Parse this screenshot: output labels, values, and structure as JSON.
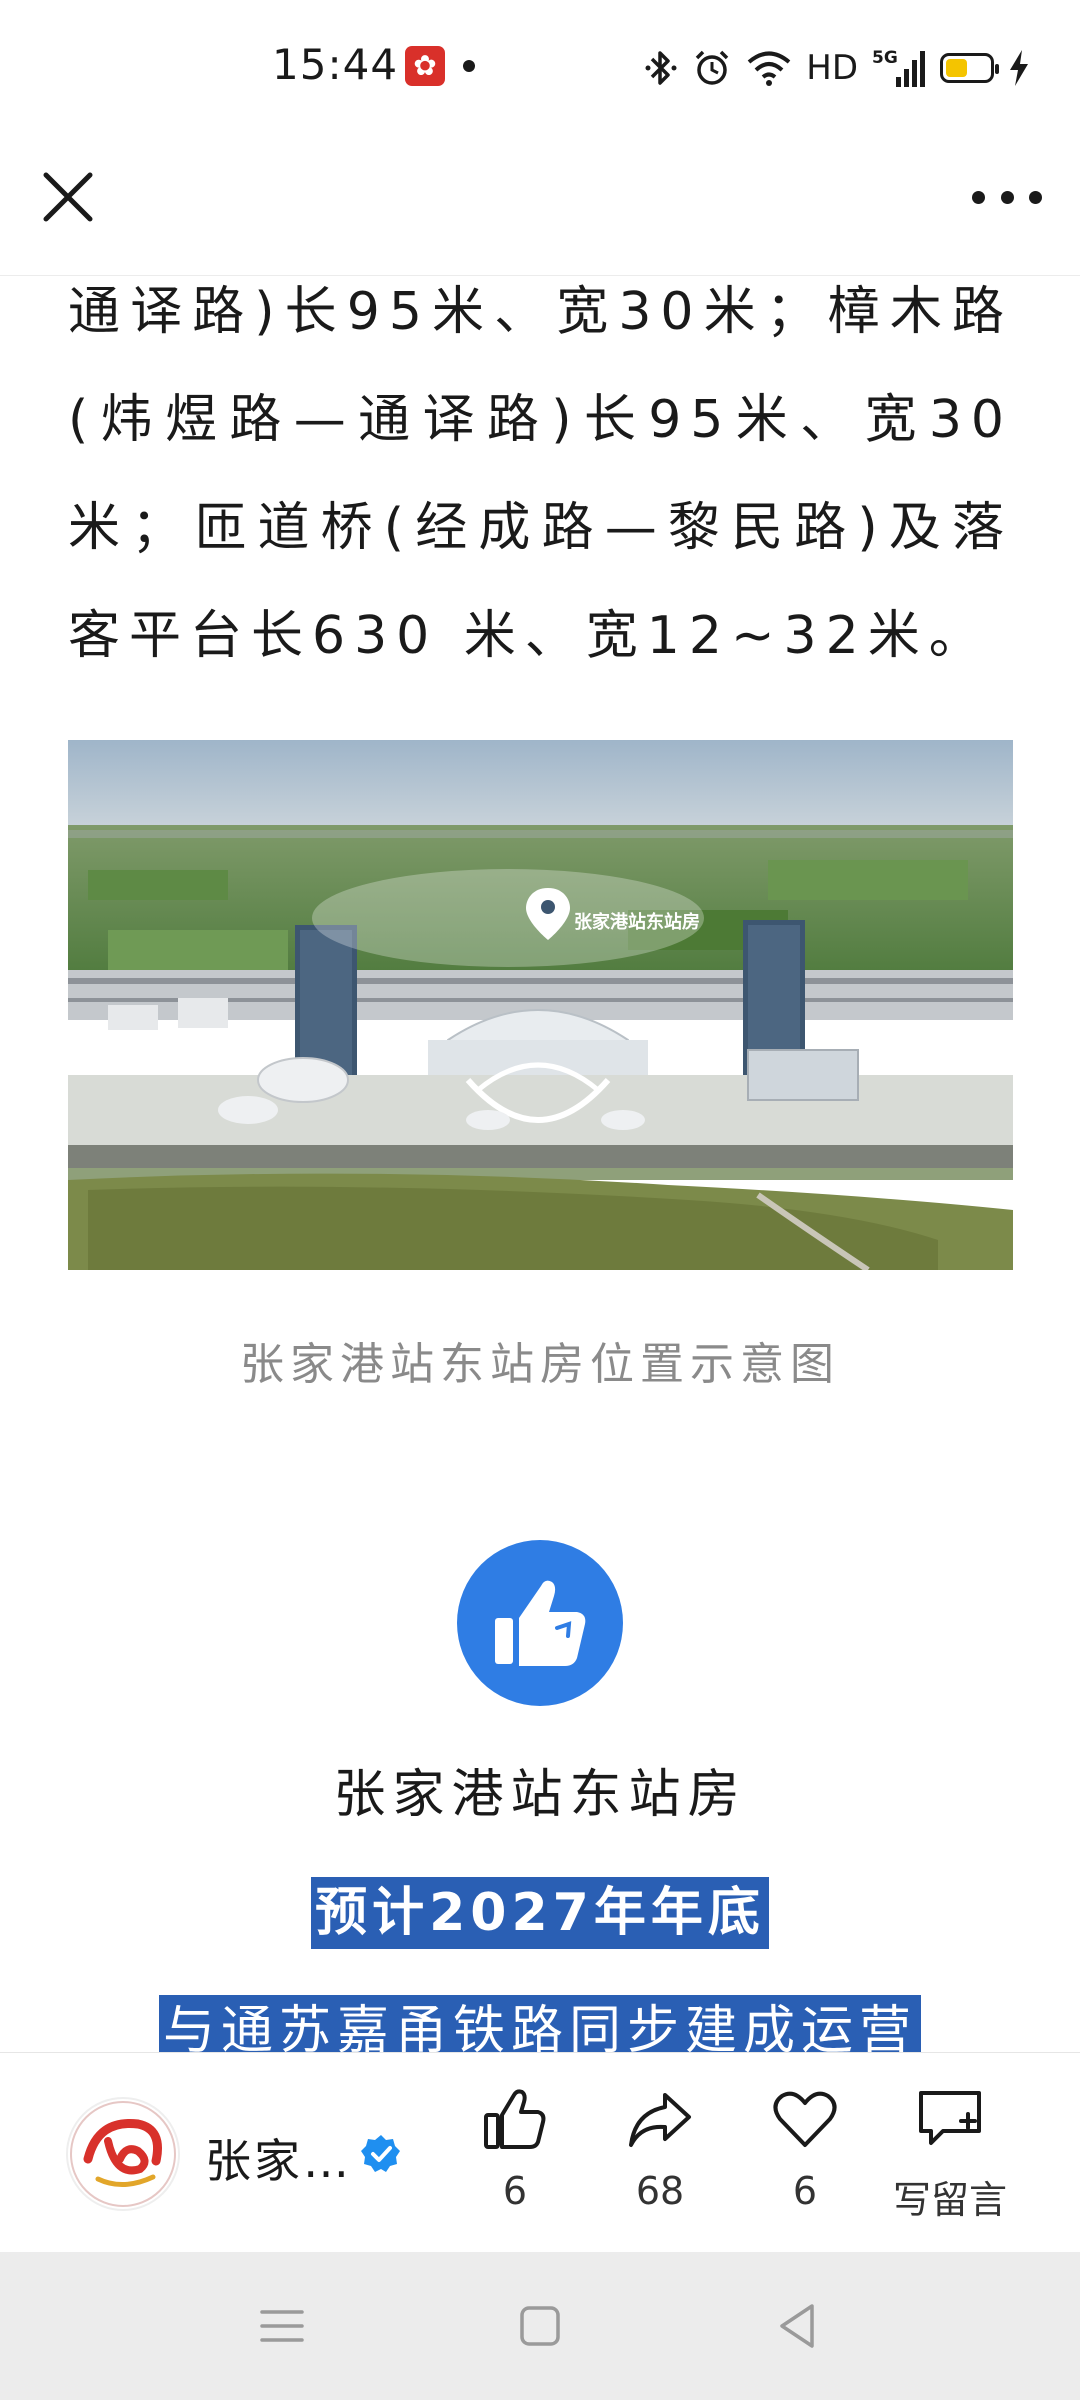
{
  "status_bar": {
    "time": "15:44",
    "network_label": "HD",
    "signal_label": "5G",
    "battery_level": 0.5,
    "icons": [
      "app-notification-icon",
      "bluetooth-icon",
      "alarm-icon",
      "wifi-icon",
      "signal-icon",
      "battery-icon",
      "charging-icon"
    ]
  },
  "nav": {
    "close_icon": "close-icon",
    "more_icon": "more-icon"
  },
  "article": {
    "paragraph": "通译路)长95米、宽30米；樟木路(炜煜路—通译路)长95米、宽30米；匝道桥(经成路—黎民路)及落客平台长630 米、宽12~32米。",
    "image_label": "张家港站东站房",
    "image_caption": "张家港站东站房位置示意图",
    "headline": "张家港站东站房",
    "highlight_1": "预计2027年年底",
    "highlight_2": "与通苏嘉甬铁路同步建成运营"
  },
  "action_bar": {
    "account_name": "张家…",
    "like_count": "6",
    "share_count": "68",
    "favorite_count": "6",
    "comment_label": "写留言"
  },
  "colors": {
    "accent_blue": "#2f7de4",
    "highlight_bg": "#2a5fb4",
    "caption_gray": "#8a8a8a",
    "verified_blue": "#1f8ff0"
  }
}
